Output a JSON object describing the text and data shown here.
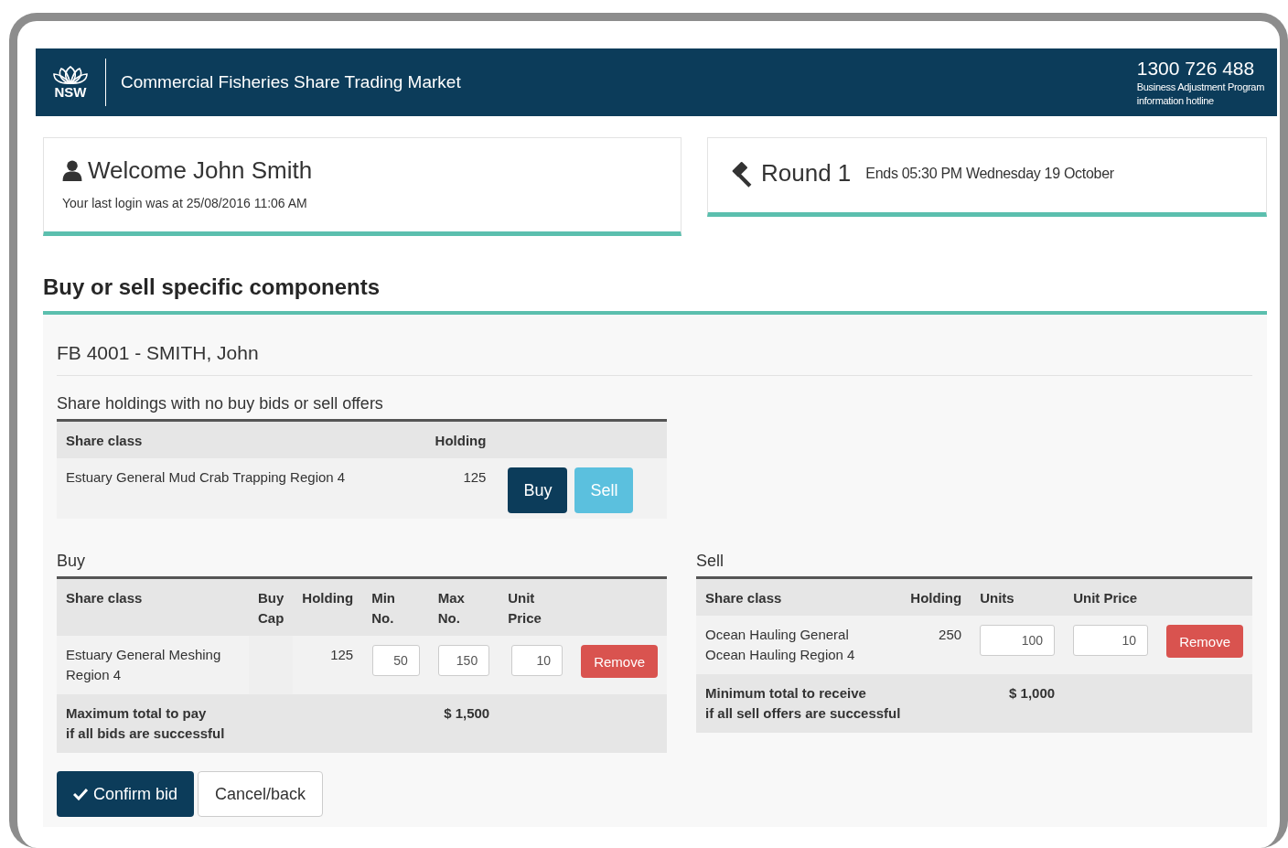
{
  "header": {
    "logo_text": "NSW",
    "title": "Commercial Fisheries Share Trading Market",
    "phone": "1300 726 488",
    "phone_caption": [
      "Business Adjustment Program",
      "information hotline"
    ]
  },
  "welcome": {
    "title": "Welcome John Smith",
    "last_login": "Your last login was at 25/08/2016 11:06 AM"
  },
  "round": {
    "title": "Round 1",
    "ends": "Ends 05:30 PM Wednesday 19 October"
  },
  "section_title": "Buy or sell specific components",
  "account": "FB 4001 - SMITH, John",
  "holdings": {
    "title": "Share holdings with no buy bids or sell offers",
    "columns": [
      "Share class",
      "Holding"
    ],
    "rows": [
      {
        "share_class": "Estuary General Mud Crab Trapping Region 4",
        "holding": "125",
        "buttons": [
          {
            "label": "Buy",
            "kind": "primary"
          },
          {
            "label": "Sell",
            "kind": "info"
          }
        ]
      }
    ]
  },
  "buy": {
    "title": "Buy",
    "columns": [
      "Share class",
      "Buy Cap",
      "Holding",
      "Min No.",
      "Max No.",
      "Unit Price"
    ],
    "rows": [
      {
        "share_class": "Estuary General Meshing Region 4",
        "holding": "125",
        "min": "50",
        "max": "150",
        "unit_price": "10",
        "remove": "Remove"
      }
    ],
    "total_label": [
      "Maximum total to pay",
      "if all bids are successful"
    ],
    "total_value": "$ 1,500"
  },
  "sell": {
    "title": "Sell",
    "columns": [
      "Share class",
      "Holding",
      "Units",
      "Unit Price"
    ],
    "rows": [
      {
        "share_class": "Ocean Hauling General Ocean Hauling Region 4",
        "holding": "250",
        "units": "100",
        "unit_price": "10",
        "remove": "Remove"
      }
    ],
    "total_label": [
      "Minimum total to receive",
      "if all sell offers are successful"
    ],
    "total_value": "$ 1,000"
  },
  "actions": [
    {
      "label": "Confirm bid",
      "kind": "primary"
    },
    {
      "label": "Cancel/back",
      "kind": "default"
    }
  ]
}
